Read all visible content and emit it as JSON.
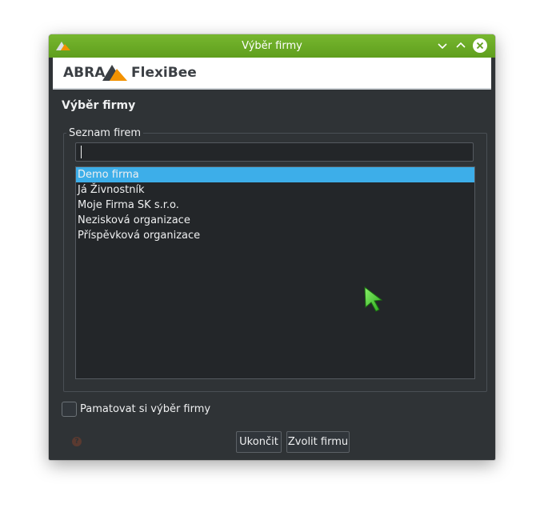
{
  "window": {
    "title": "Výběr firmy"
  },
  "banner": {
    "brand_left": "ABRA",
    "brand_right": "FlexiBee"
  },
  "dialog": {
    "heading": "Výběr firmy",
    "group_label": "Seznam firem",
    "search": {
      "value": "",
      "placeholder": ""
    },
    "companies": [
      {
        "label": "Demo firma",
        "selected": true
      },
      {
        "label": "Já Živnostník",
        "selected": false
      },
      {
        "label": "Moje Firma SK s.r.o.",
        "selected": false
      },
      {
        "label": "Nezisková organizace",
        "selected": false
      },
      {
        "label": "Příspěvková organizace",
        "selected": false
      }
    ],
    "remember_label": "Pamatovat si výběr firmy",
    "remember_checked": false,
    "buttons": {
      "quit": "Ukončit",
      "choose": "Zvolit firmu"
    }
  },
  "colors": {
    "titlebar": "#6aab25",
    "selection": "#3daee9",
    "background": "#2f3336",
    "list_background": "#232629",
    "logo_orange": "#f39200",
    "cursor_green": "#4fd13b"
  },
  "icons": [
    "app-icon",
    "minimize-icon",
    "maximize-icon",
    "close-icon",
    "abra-logo-icon",
    "help-icon",
    "cursor-icon"
  ]
}
